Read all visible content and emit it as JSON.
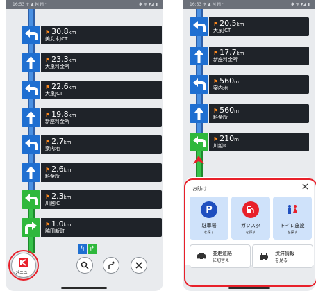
{
  "left_screen": {
    "status_bar": {
      "left": "16:53 ✈ ▲ M M ·",
      "right": "✱ ᯤ ▾◢ ▮"
    },
    "guidance": [
      {
        "dir": "left",
        "distance": "30.8",
        "unit": "km",
        "name": "美女木JCT",
        "color": "blue"
      },
      {
        "dir": "up",
        "distance": "23.3",
        "unit": "km",
        "name": "大泉料金所",
        "color": "blue"
      },
      {
        "dir": "left",
        "distance": "22.6",
        "unit": "km",
        "name": "大泉JCT",
        "color": "blue"
      },
      {
        "dir": "up",
        "distance": "19.8",
        "unit": "km",
        "name": "新座料金所",
        "color": "blue"
      },
      {
        "dir": "left",
        "distance": "2.7",
        "unit": "km",
        "name": "案内地",
        "color": "blue"
      },
      {
        "dir": "up",
        "distance": "2.6",
        "unit": "km",
        "name": "料金所",
        "color": "blue"
      },
      {
        "dir": "left",
        "distance": "2.3",
        "unit": "km",
        "name": "川越IC",
        "color": "green"
      },
      {
        "dir": "right",
        "distance": "1.0",
        "unit": "km",
        "name": "脇田新町",
        "color": "green"
      }
    ],
    "menu_label": "メニュー",
    "controls": {
      "search_icon": "search-icon",
      "route_icon": "route-icon",
      "close_icon": "close-icon"
    }
  },
  "right_screen": {
    "status_bar": {
      "left": "16:53 ✈ ▲ M M ·",
      "right": "✱ ᯤ ▾◢ ▮"
    },
    "guidance": [
      {
        "dir": "left",
        "distance": "20.5",
        "unit": "km",
        "name": "大泉JCT",
        "color": "blue"
      },
      {
        "dir": "up",
        "distance": "17.7",
        "unit": "km",
        "name": "新座料金所",
        "color": "blue"
      },
      {
        "dir": "left",
        "distance": "560",
        "unit": "m",
        "name": "案内地",
        "color": "blue"
      },
      {
        "dir": "up",
        "distance": "560",
        "unit": "m",
        "name": "料金所",
        "color": "blue"
      },
      {
        "dir": "left",
        "distance": "210",
        "unit": "m",
        "name": "川越IC",
        "color": "green"
      }
    ],
    "help_sheet": {
      "title": "お助け",
      "tiles": [
        {
          "label": "駐車場",
          "sub": "を探す",
          "icon": "parking-icon"
        },
        {
          "label": "ガソスタ",
          "sub": "を探す",
          "icon": "gas-station-icon"
        },
        {
          "label": "トイレ施設",
          "sub": "を探す",
          "icon": "toilet-icon"
        }
      ],
      "wide_buttons": [
        {
          "line1": "並走道路",
          "line2": "に切替え",
          "icon": "parallel-road-icon"
        },
        {
          "line1": "渋滞情報",
          "line2": "を見る",
          "icon": "traffic-info-icon"
        }
      ]
    }
  },
  "colors": {
    "blue": "#1f6fd1",
    "green": "#2fb83c",
    "dark": "#1f2329",
    "highlight": "#e8202a",
    "flag": "#ff8a1f"
  }
}
